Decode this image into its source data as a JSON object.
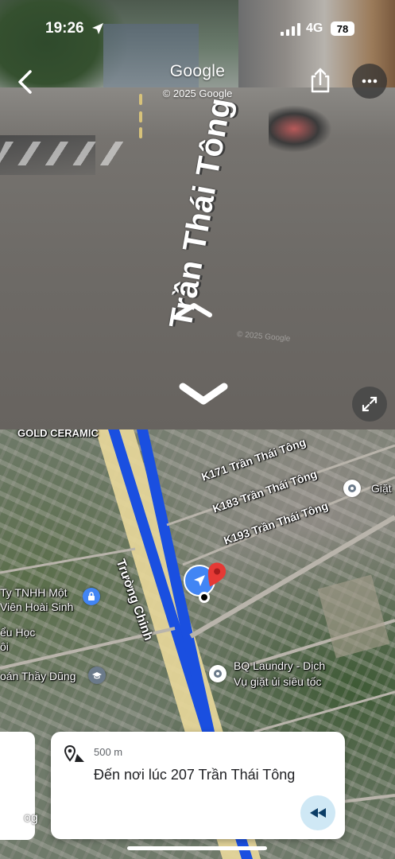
{
  "status_bar": {
    "time": "19:26",
    "network": "4G",
    "battery": "78"
  },
  "street_view": {
    "brand": "Google",
    "copyright": "© 2025 Google",
    "street_label": "Trần Thái Tông",
    "watermark": "© 2025 Google"
  },
  "map": {
    "labels": {
      "gold_ceramic": "GOLD CERAMIC",
      "k171": "K171 Trần Thái Tông",
      "k183": "K183 Trần Thái Tông",
      "k193": "K193 Trần Thái Tông",
      "truong_chinh": "Trường Chinh",
      "ty_tnhh_1": "Ty TNHH Một",
      "ty_tnhh_2": "Viên Hoài Sinh",
      "hoc_1": "ểu Học",
      "hoc_2": "ôi",
      "thay_dung": "oán Thầy Dũng",
      "laundry_1": "BQ Laundry - Dịch",
      "laundry_2": "Vụ giặt ủi siêu tốc",
      "giat": "Giặt"
    },
    "route_color": "#1a4fe0",
    "road_color": "#e7d79a"
  },
  "nav_card": {
    "distance": "500 m",
    "destination": "Đến nơi lúc 207 Trần Thái Tông"
  },
  "left_card": {
    "partial_text": "og"
  },
  "colors": {
    "accent": "#4285f4",
    "pin": "#e53935",
    "rewind_bg": "#cfe8f5"
  }
}
